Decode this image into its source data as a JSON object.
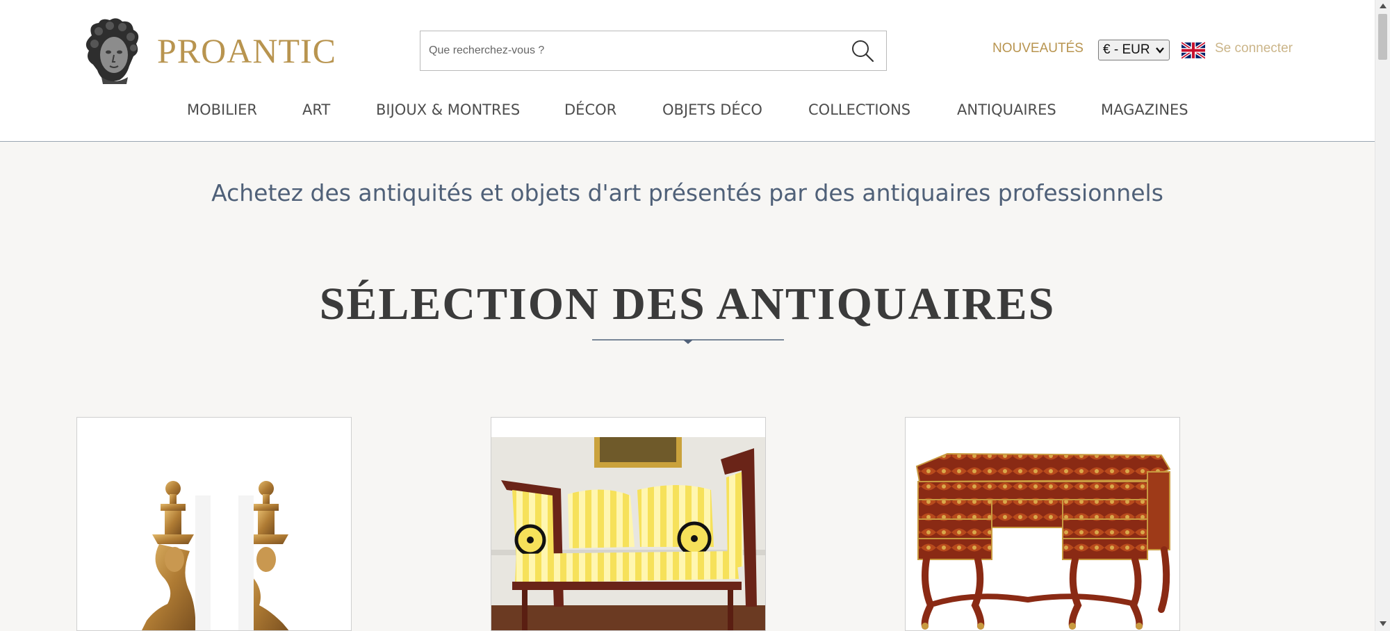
{
  "header": {
    "brand": "PROANTIC",
    "search": {
      "placeholder": "Que recherchez-vous ?"
    },
    "nouveautes_label": "NOUVEAUTÉS",
    "currency": {
      "selected": "€ - EUR"
    },
    "login_label": "Se connecter"
  },
  "nav": {
    "items": [
      {
        "label": "MOBILIER"
      },
      {
        "label": "ART"
      },
      {
        "label": "BIJOUX & MONTRES"
      },
      {
        "label": "DÉCOR"
      },
      {
        "label": "OBJETS DÉCO"
      },
      {
        "label": "COLLECTIONS"
      },
      {
        "label": "ANTIQUAIRES"
      },
      {
        "label": "MAGAZINES"
      }
    ]
  },
  "main": {
    "tagline": "Achetez des antiquités et objets d'art présentés par des antiquaires professionnels",
    "section_title": "SÉLECTION DES ANTIQUAIRES"
  },
  "products": [
    {
      "icon": "gilt-andirons-image"
    },
    {
      "icon": "yellow-striped-sofa-image"
    },
    {
      "icon": "boulle-mazarin-desk-image"
    }
  ],
  "colors": {
    "brand_gold": "#b8944f",
    "accent_blue": "#4f6078",
    "background": "#f7f6f4"
  }
}
